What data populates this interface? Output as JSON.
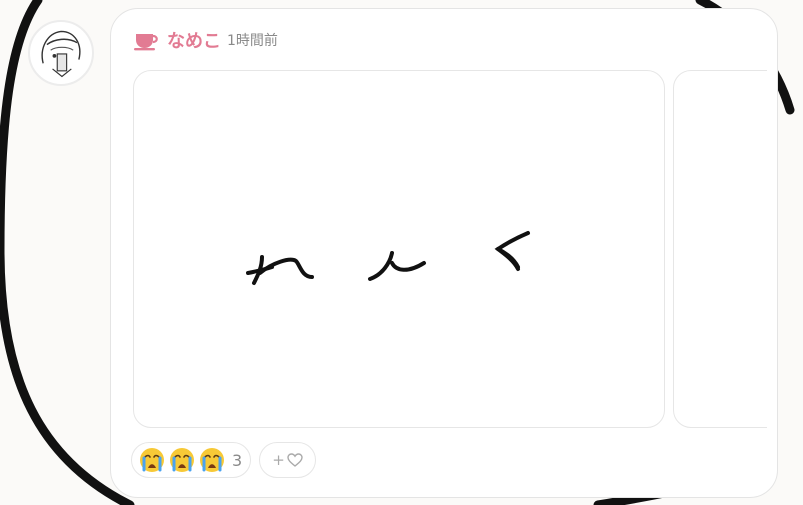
{
  "post": {
    "username": "なめこ",
    "timestamp": "1時間前",
    "user_icon": "teacup-icon",
    "accent_color": "#e27b93"
  },
  "drawing": {
    "handwritten_text": "れんく"
  },
  "reactions": {
    "emoji": "crying-face-icon",
    "emoji_shown": 3,
    "count": "3",
    "add_label": "+"
  }
}
